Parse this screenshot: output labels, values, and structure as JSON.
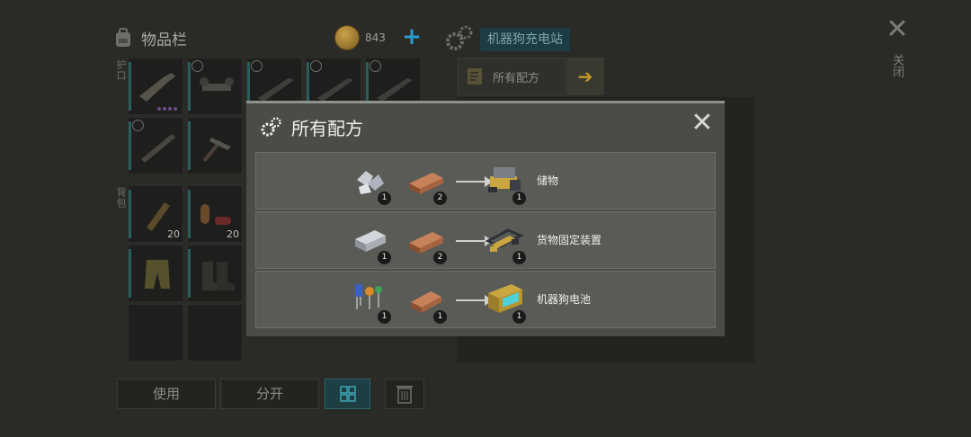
{
  "inventory": {
    "title": "物品栏",
    "coins": "843",
    "section_equipped": "护口",
    "section_backpack": "背包",
    "slot_counts": [
      "20",
      "20"
    ]
  },
  "bottom_buttons": {
    "use": "使用",
    "split": "分开"
  },
  "station": {
    "name": "机器狗充电站",
    "recipe_tab": "所有配方"
  },
  "close_label": "关闭",
  "modal": {
    "title": "所有配方",
    "recipes": [
      {
        "ingredients": [
          {
            "icon": "metal-scrap-icon",
            "qty": "1"
          },
          {
            "icon": "copper-ingot-icon",
            "qty": "2"
          }
        ],
        "output": {
          "icon": "storage-module-icon",
          "qty": "1",
          "name": "储物"
        }
      },
      {
        "ingredients": [
          {
            "icon": "steel-ingot-icon",
            "qty": "1"
          },
          {
            "icon": "copper-ingot-icon",
            "qty": "2"
          }
        ],
        "output": {
          "icon": "cargo-mount-icon",
          "qty": "1",
          "name": "货物固定装置"
        }
      },
      {
        "ingredients": [
          {
            "icon": "electronic-components-icon",
            "qty": "1"
          },
          {
            "icon": "copper-ingot-icon",
            "qty": "1"
          }
        ],
        "output": {
          "icon": "robot-dog-battery-icon",
          "qty": "1",
          "name": "机器狗电池"
        }
      }
    ]
  },
  "colors": {
    "accent_blue": "#2d9bd0",
    "arrow_gold": "#c59b2a",
    "modal_bg": "#4a4c47",
    "row_bg": "#595b56"
  }
}
